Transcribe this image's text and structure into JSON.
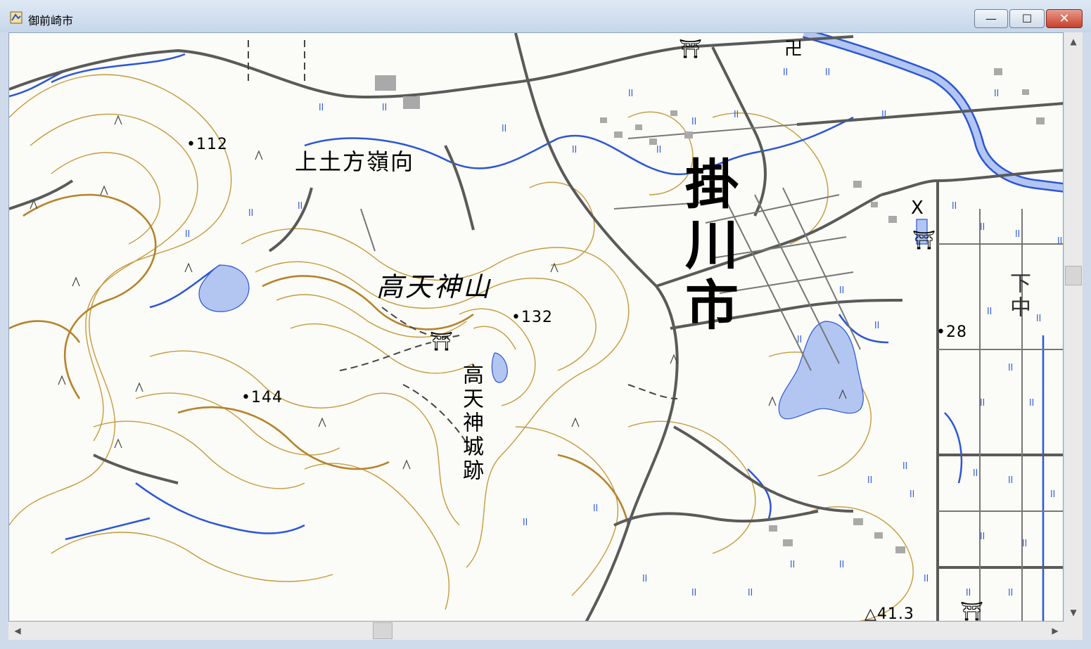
{
  "window": {
    "title": "御前崎市",
    "minimize_symbol": "—",
    "maximize_symbol": "☐",
    "close_symbol": "✕"
  },
  "map": {
    "district_label": "上土方嶺向",
    "mountain_label": "高天神山",
    "city_label": "掛川市",
    "castle_label": "高天神城跡",
    "village_label": "下中",
    "elevations": [
      "•112",
      "•144",
      "•132",
      "•28",
      "△41.3"
    ],
    "symbols": {
      "shrine": "⛩",
      "temple": "卍",
      "police": "X"
    },
    "colors": {
      "contour": "#c59a3c",
      "road": "#5a5a5a",
      "water": "#2a56d8",
      "pond": "#b3c6f2",
      "paper": "#fbfbf7"
    }
  },
  "scrollbars": {
    "up": "▲",
    "down": "▼",
    "left": "◀",
    "right": "▶",
    "vertical_position": 0.42,
    "horizontal_position": 0.35
  }
}
